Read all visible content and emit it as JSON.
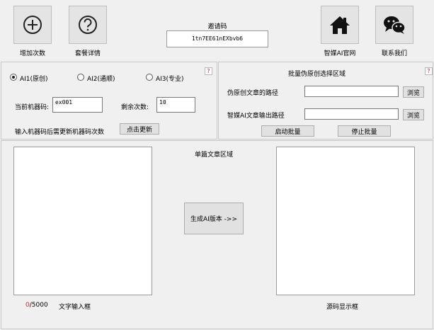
{
  "toolbar": {
    "add_count_label": "增加次数",
    "package_details_label": "套餐详情",
    "official_site_label": "智媒AI官网",
    "contact_label": "联系我们"
  },
  "invite": {
    "label": "邀请码",
    "code": "1tn7EE61nEXbvb6"
  },
  "ai_modes": {
    "options": [
      "AI1(原创)",
      "AI2(通顺)",
      "AI3(专业)"
    ],
    "selected": "AI1(原创)"
  },
  "machine": {
    "code_label": "当前机器码:",
    "code_value": "ex001",
    "remaining_label": "剩余次数:",
    "remaining_value": "10",
    "update_hint": "输入机器码后需更新机器码次数",
    "update_button": "点击更新"
  },
  "batch": {
    "title": "批量伪原创选择区域",
    "source_label": "伪原创文章的路径",
    "source_value": "",
    "output_label": "智媒AI文章输出路径",
    "output_value": "",
    "browse_label": "浏览",
    "start_button": "启动批量",
    "stop_button": "停止批量"
  },
  "single": {
    "title": "单篇文章区域",
    "generate_button": "生成AI版本 ->>",
    "char_count": "0",
    "char_limit": "/5000",
    "input_label": "文字输入框",
    "output_label": "源码显示框"
  },
  "help_glyph": "?",
  "colors": {
    "accent_red": "#dd2222",
    "panel_bg": "#f0f0f0"
  }
}
